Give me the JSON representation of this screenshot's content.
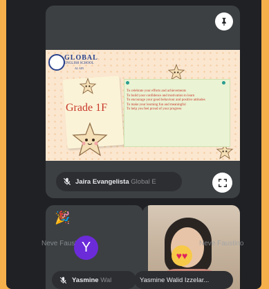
{
  "main_tile": {
    "slide": {
      "school_name": "GLOBAL",
      "school_subtitle": "ENGLISH SCHOOL",
      "school_location": "AL AIN",
      "grade": "Grade 1F",
      "goals": [
        "To celebrate your efforts and achievements",
        "To build your confidence and motivation to learn",
        "To encourage your good behaviour and positive attitudes",
        "To make your learning fun and meaningful",
        "To help you feel proud of your progress"
      ]
    },
    "participant_first": "Jaira Evangelista",
    "participant_rest": "Global E",
    "pin_icon": "pin-icon",
    "fullscreen_icon": "fullscreen-icon"
  },
  "tile_left": {
    "reaction_emoji": "🎉",
    "avatar_letter": "Y",
    "ghost_name": "Neve Faustino",
    "participant_first": "Yasmine",
    "participant_rest": "Wal"
  },
  "tile_right": {
    "ghost_name": "Neve Faustino",
    "participant_name": "Yasmine Walid Izzelar..."
  },
  "colors": {
    "frame": "#f5b04c",
    "background": "#202124",
    "tile": "#3c4043",
    "avatar": "#6c2bd9"
  }
}
